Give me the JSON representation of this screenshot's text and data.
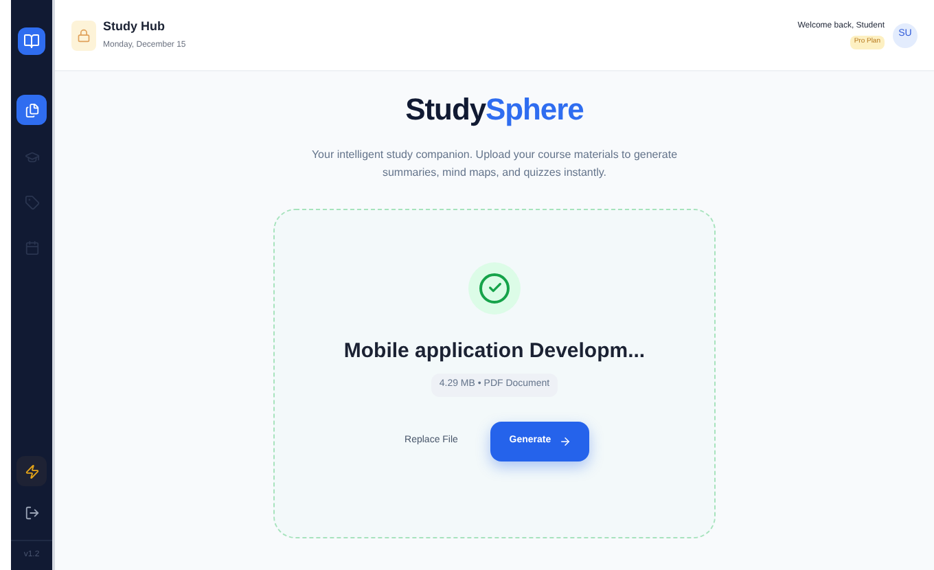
{
  "sidebar": {
    "nav": [
      {
        "kind": "files",
        "selected": true
      },
      {
        "kind": "cap",
        "selected": false
      },
      {
        "kind": "tag",
        "selected": false
      },
      {
        "kind": "calendar",
        "selected": false
      }
    ],
    "version": "v1.2"
  },
  "header": {
    "title": "Study Hub",
    "date": "Monday, December 15",
    "welcome": "Welcome back, Student",
    "plan": "Pro Plan",
    "avatar": "SU"
  },
  "hero": {
    "brand_start": "Study",
    "brand_end": "Sphere",
    "tagline": "Your intelligent study companion. Upload your course materials to generate summaries, mind maps, and quizzes instantly."
  },
  "upload": {
    "file_name": "Mobile application Developm...",
    "file_info": "4.29 MB • PDF Document",
    "replace": "Replace File",
    "generate": "Generate"
  }
}
